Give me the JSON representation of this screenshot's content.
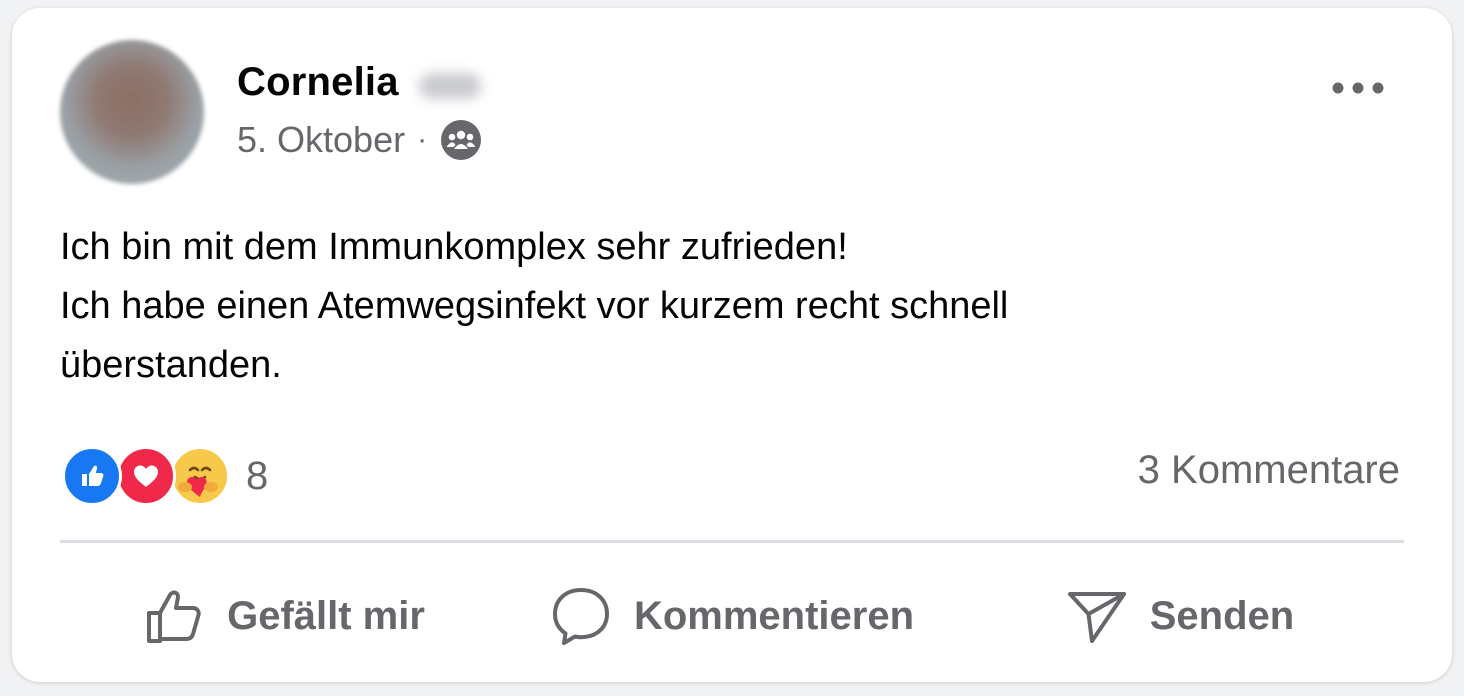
{
  "post": {
    "author": "Cornelia",
    "date": "5. Oktober",
    "separator": "·",
    "audience_icon": "group-icon",
    "body_lines": [
      "Ich bin mit dem Immunkomplex sehr zufrieden!",
      "Ich habe einen Atemwegsinfekt vor kurzem recht schnell",
      "überstanden."
    ]
  },
  "reactions": {
    "types": [
      "like",
      "love",
      "care"
    ],
    "count": "8",
    "comments_label": "3 Kommentare"
  },
  "actions": {
    "like_label": "Gefällt mir",
    "comment_label": "Kommentieren",
    "send_label": "Senden"
  },
  "colors": {
    "like_blue": "#1877f2",
    "love_red": "#f02849",
    "care_yellow": "#f7c94b",
    "secondary_text": "#65676b"
  }
}
